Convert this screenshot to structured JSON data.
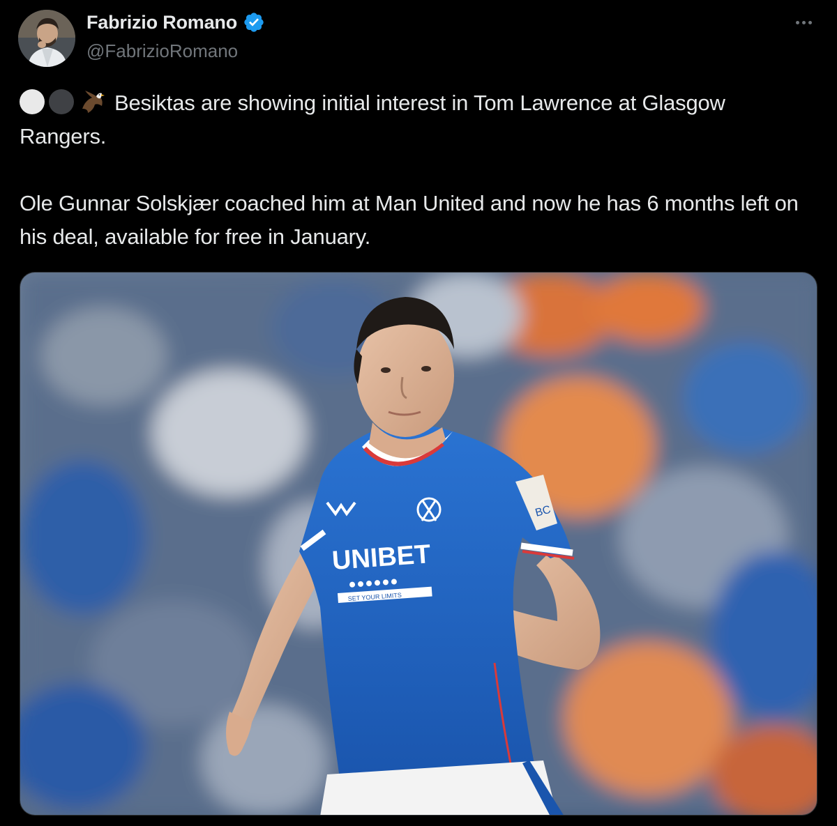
{
  "author": {
    "display_name": "Fabrizio Romano",
    "handle": "@FabrizioRomano",
    "verified": true,
    "avatar_icon": "profile-photo"
  },
  "menu": {
    "icon": "more-horizontal-icon"
  },
  "tweet": {
    "emojis": [
      "white-circle",
      "black-circle",
      "eagle"
    ],
    "paragraph_1": "Besiktas are showing initial interest in Tom Lawrence at Glasgow Rangers.",
    "paragraph_2": "Ole Gunnar Solskjær coached him at Man United and now he has 6 months left on his deal, available for free in January."
  },
  "media": {
    "type": "photo",
    "shirt_sponsor": "UNIBET",
    "shirt_tagline": "SET YOUR LIMITS",
    "sleeve_text": "BC",
    "colors": {
      "shirt": "#1f63c4",
      "collar": "#d93a3a",
      "crowd_orange": "#e0783a",
      "crowd_blue": "#3a6fb8"
    }
  },
  "colors": {
    "background": "#000000",
    "text": "#e7e9ea",
    "secondary": "#71767b",
    "verified": "#1d9bf0"
  }
}
